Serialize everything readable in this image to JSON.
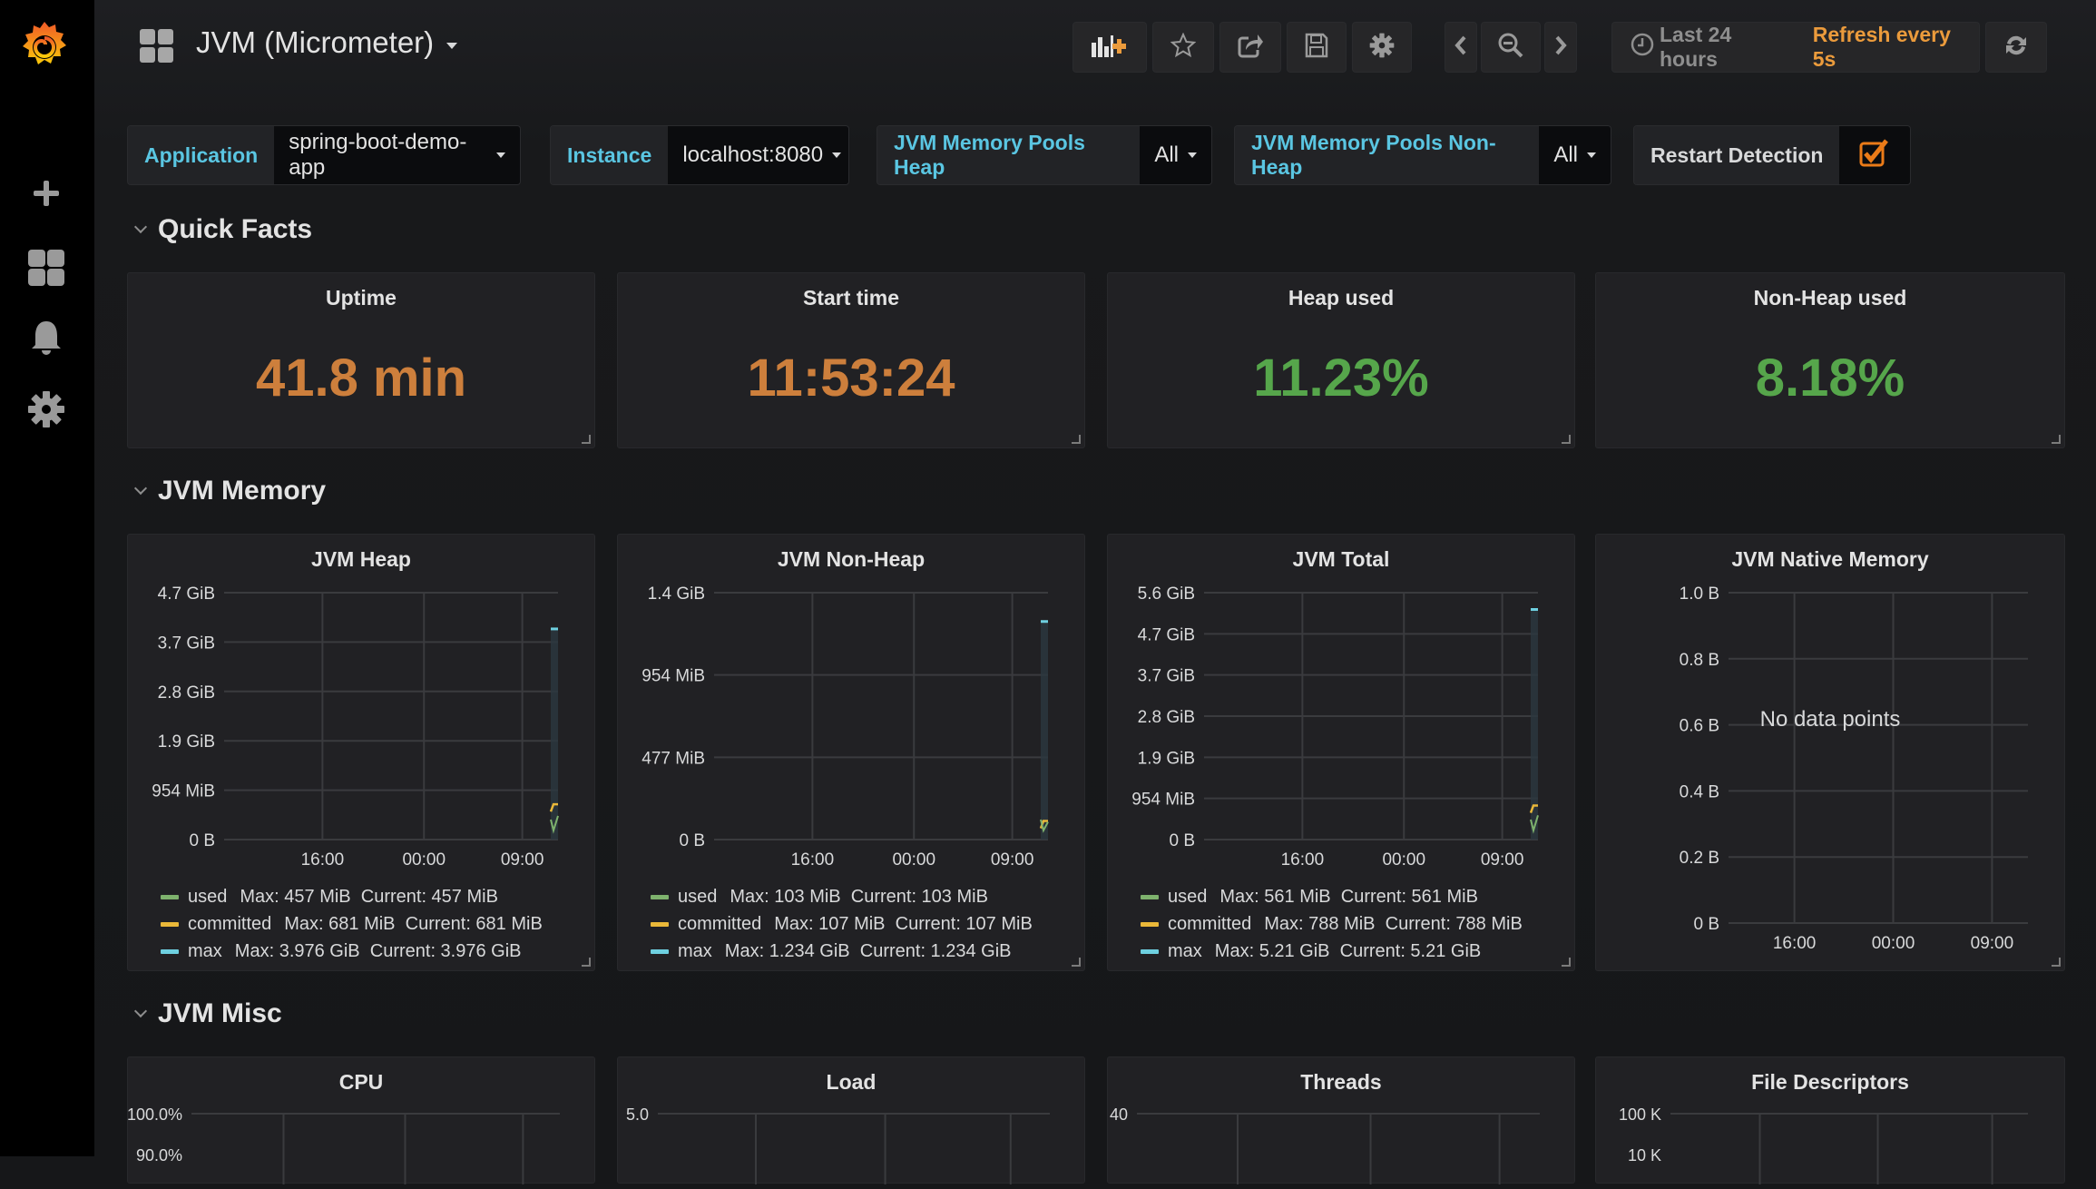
{
  "sidemenu": {
    "logo": "grafana-logo",
    "items": [
      {
        "icon": "plus-icon",
        "label": "Create"
      },
      {
        "icon": "dashboards-icon",
        "label": "Dashboards"
      },
      {
        "icon": "bell-icon",
        "label": "Alerting"
      },
      {
        "icon": "gear-icon",
        "label": "Configuration"
      }
    ]
  },
  "navbar": {
    "title": "JVM (Micrometer)",
    "buttons": [
      {
        "icon": "add-panel-icon",
        "label": "Add panel"
      },
      {
        "icon": "star-icon",
        "label": "Mark as favorite"
      },
      {
        "icon": "share-icon",
        "label": "Share dashboard"
      },
      {
        "icon": "save-icon",
        "label": "Save dashboard"
      },
      {
        "icon": "gear-icon",
        "label": "Settings"
      },
      {
        "icon": "chevron-left-icon",
        "label": "Shift time backward"
      },
      {
        "icon": "zoom-out-icon",
        "label": "Zoom out"
      },
      {
        "icon": "chevron-right-icon",
        "label": "Shift time forward"
      },
      {
        "icon": "refresh-icon",
        "label": "Refresh"
      }
    ],
    "time_range": "Last 24 hours",
    "refresh_interval": "Refresh every 5s",
    "accent": "#eb9b3c"
  },
  "variables": [
    {
      "label": "Application",
      "value": "spring-boot-demo-app"
    },
    {
      "label": "Instance",
      "value": "localhost:8080"
    },
    {
      "label": "JVM Memory Pools Heap",
      "value": "All"
    },
    {
      "label": "JVM Memory Pools Non-Heap",
      "value": "All"
    },
    {
      "label": "Restart Detection",
      "checked": true
    }
  ],
  "rows": {
    "quick_facts": {
      "title": "Quick Facts",
      "panels": [
        {
          "title": "Uptime",
          "value": "41.8 min",
          "color": "#cd7f3c"
        },
        {
          "title": "Start time",
          "value": "11:53:24",
          "color": "#cd7f3c"
        },
        {
          "title": "Heap used",
          "value": "11.23%",
          "color": "#56a64b"
        },
        {
          "title": "Non-Heap used",
          "value": "8.18%",
          "color": "#56a64b"
        }
      ]
    },
    "jvm_memory": {
      "title": "JVM Memory"
    },
    "jvm_misc": {
      "title": "JVM Misc",
      "panels": [
        {
          "title": "CPU",
          "y_top": "100.0%",
          "y_next": "90.0%"
        },
        {
          "title": "Load",
          "y_top": "5.0"
        },
        {
          "title": "Threads",
          "y_top": "40"
        },
        {
          "title": "File Descriptors",
          "y_top": "100 K",
          "y_next": "10 K"
        }
      ]
    }
  },
  "series_colors": {
    "used": "#7eb26d",
    "committed": "#eab839",
    "max": "#6ed0e0"
  },
  "chart_data": [
    {
      "type": "line",
      "title": "JVM Heap",
      "x_ticks": [
        "16:00",
        "00:00",
        "09:00"
      ],
      "y_ticks": [
        "0 B",
        "954 MiB",
        "1.9 GiB",
        "2.8 GiB",
        "3.7 GiB",
        "4.7 GiB"
      ],
      "ylim_gib": [
        0,
        4.66
      ],
      "series": [
        {
          "name": "used",
          "max": "457 MiB",
          "current": "457 MiB",
          "current_gib": 0.446
        },
        {
          "name": "committed",
          "max": "681 MiB",
          "current": "681 MiB",
          "current_gib": 0.665
        },
        {
          "name": "max",
          "max": "3.976 GiB",
          "current": "3.976 GiB",
          "current_gib": 3.976
        }
      ]
    },
    {
      "type": "line",
      "title": "JVM Non-Heap",
      "x_ticks": [
        "16:00",
        "00:00",
        "09:00"
      ],
      "y_ticks": [
        "0 B",
        "477 MiB",
        "954 MiB",
        "1.4 GiB"
      ],
      "ylim_gib": [
        0,
        1.397
      ],
      "series": [
        {
          "name": "used",
          "max": "103 MiB",
          "current": "103 MiB",
          "current_gib": 0.1
        },
        {
          "name": "committed",
          "max": "107 MiB",
          "current": "107 MiB",
          "current_gib": 0.105
        },
        {
          "name": "max",
          "max": "1.234 GiB",
          "current": "1.234 GiB",
          "current_gib": 1.234
        }
      ]
    },
    {
      "type": "line",
      "title": "JVM Total",
      "x_ticks": [
        "16:00",
        "00:00",
        "09:00"
      ],
      "y_ticks": [
        "0 B",
        "954 MiB",
        "1.9 GiB",
        "2.8 GiB",
        "3.7 GiB",
        "4.7 GiB",
        "5.6 GiB"
      ],
      "ylim_gib": [
        0,
        5.59
      ],
      "series": [
        {
          "name": "used",
          "max": "561 MiB",
          "current": "561 MiB",
          "current_gib": 0.548
        },
        {
          "name": "committed",
          "max": "788 MiB",
          "current": "788 MiB",
          "current_gib": 0.77
        },
        {
          "name": "max",
          "max": "5.21 GiB",
          "current": "5.21 GiB",
          "current_gib": 5.21
        }
      ]
    },
    {
      "type": "line",
      "title": "JVM Native Memory",
      "x_ticks": [
        "16:00",
        "00:00",
        "09:00"
      ],
      "y_ticks": [
        "0 B",
        "0.2 B",
        "0.4 B",
        "0.6 B",
        "0.8 B",
        "1.0 B"
      ],
      "ylim": [
        0,
        1
      ],
      "series": [],
      "message": "No data points"
    }
  ]
}
